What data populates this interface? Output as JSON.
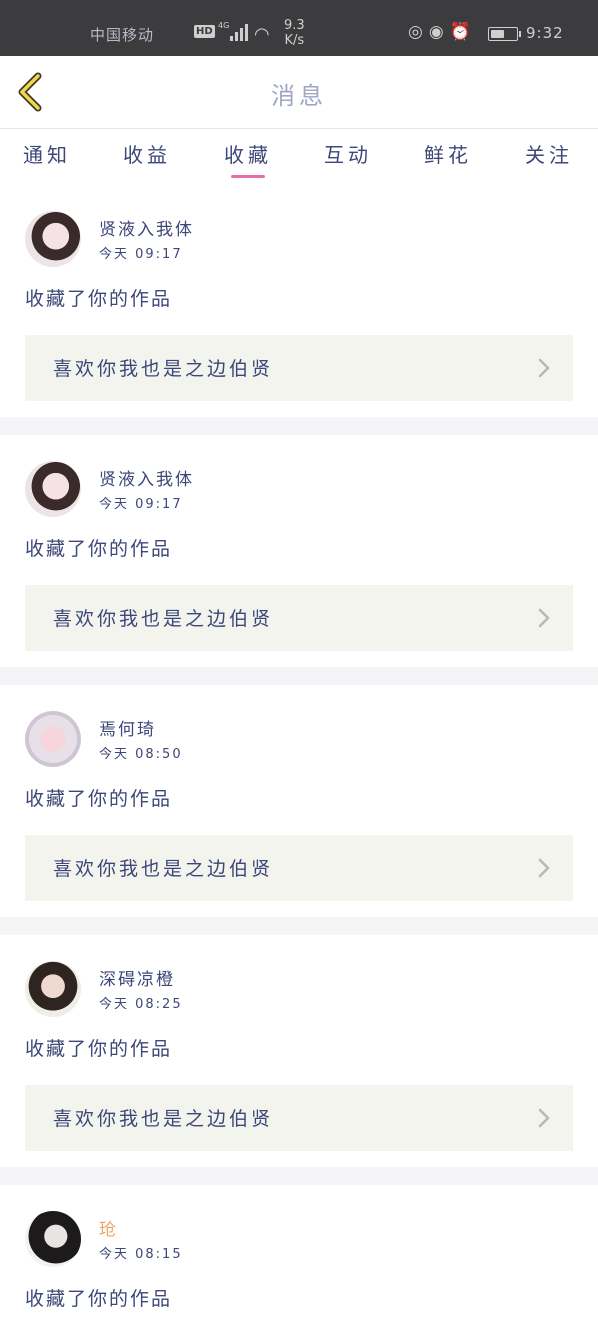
{
  "status_bar": {
    "carrier": "中国移动",
    "network": "4G",
    "hd": "HD",
    "speed_value": "9.3",
    "speed_unit": "K/s",
    "time": "9:32",
    "battery_level": 0.55
  },
  "header": {
    "title": "消息"
  },
  "tabs": [
    {
      "label": "通知"
    },
    {
      "label": "收益"
    },
    {
      "label": "收藏"
    },
    {
      "label": "互动"
    },
    {
      "label": "鲜花"
    },
    {
      "label": "关注"
    }
  ],
  "active_tab": "收藏",
  "colors": {
    "accent": "#e070a8",
    "text": "#3d4778",
    "work_box_bg": "#f3f4ee",
    "highlight_name": "#f0a060"
  },
  "messages": [
    {
      "username": "贤液入我体",
      "time": "今天 09:17",
      "action": "收藏了你的作品",
      "work_title": "喜欢你我也是之边伯贤"
    },
    {
      "username": "贤液入我体",
      "time": "今天 09:17",
      "action": "收藏了你的作品",
      "work_title": "喜欢你我也是之边伯贤"
    },
    {
      "username": "焉何琦",
      "time": "今天 08:50",
      "action": "收藏了你的作品",
      "work_title": "喜欢你我也是之边伯贤"
    },
    {
      "username": "深碍凉橙",
      "time": "今天 08:25",
      "action": "收藏了你的作品",
      "work_title": "喜欢你我也是之边伯贤"
    },
    {
      "username": "玱",
      "time": "今天 08:15",
      "action": "收藏了你的作品",
      "work_title": ""
    }
  ]
}
